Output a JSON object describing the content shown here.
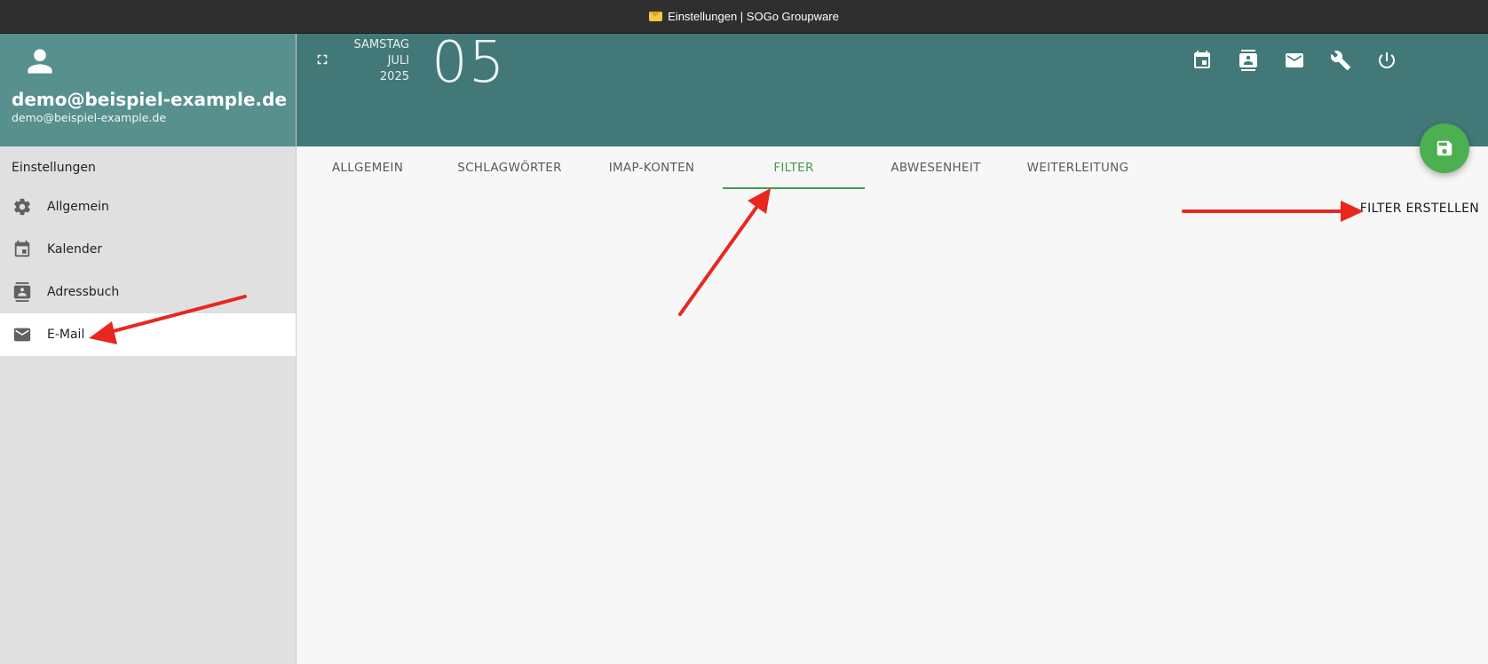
{
  "window": {
    "title": "Einstellungen | SOGo Groupware"
  },
  "user": {
    "name": "demo@beispiel-example.de",
    "email": "demo@beispiel-example.de"
  },
  "sidebar": {
    "section_title": "Einstellungen",
    "items": [
      {
        "label": "Allgemein",
        "icon": "gear-icon"
      },
      {
        "label": "Kalender",
        "icon": "calendar-icon"
      },
      {
        "label": "Adressbuch",
        "icon": "address-book-icon"
      },
      {
        "label": "E-Mail",
        "icon": "mail-icon",
        "active": true
      }
    ]
  },
  "header": {
    "weekday": "SAMSTAG",
    "month": "JULI",
    "year": "2025",
    "day": "05",
    "icons": [
      "calendar-icon",
      "contacts-icon",
      "mail-icon",
      "wrench-icon",
      "power-icon"
    ]
  },
  "tabs": [
    {
      "label": "ALLGEMEIN"
    },
    {
      "label": "SCHLAGWÖRTER"
    },
    {
      "label": "IMAP-KONTEN"
    },
    {
      "label": "FILTER",
      "active": true
    },
    {
      "label": "ABWESENHEIT"
    },
    {
      "label": "WEITERLEITUNG"
    }
  ],
  "actions": {
    "create_filter": "FILTER ERSTELLEN",
    "save": "save-icon"
  },
  "colors": {
    "sidebar_header": "#57908c",
    "header": "#427877",
    "accent": "#3f9e4c",
    "fab": "#4caf50",
    "annotation": "#e8271f"
  }
}
